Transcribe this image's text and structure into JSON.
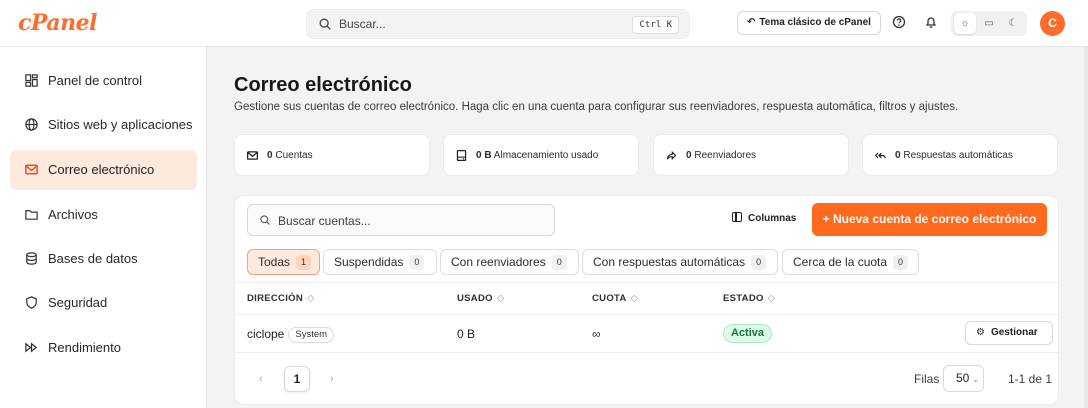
{
  "header": {
    "logo": "cPanel",
    "search_placeholder": "Buscar...",
    "search_shortcut": "Ctrl K",
    "theme_button": "Tema clásico de cPanel",
    "avatar_initial": "C",
    "accent_color": "#ff6c2c"
  },
  "sidebar": {
    "items": [
      {
        "label": "Panel de control",
        "icon": "dashboard-icon"
      },
      {
        "label": "Sitios web y aplicaciones",
        "icon": "globe-icon"
      },
      {
        "label": "Correo electrónico",
        "icon": "mail-icon",
        "active": true
      },
      {
        "label": "Archivos",
        "icon": "folder-icon"
      },
      {
        "label": "Bases de datos",
        "icon": "database-icon"
      },
      {
        "label": "Seguridad",
        "icon": "shield-icon"
      },
      {
        "label": "Rendimiento",
        "icon": "fast-forward-icon"
      }
    ]
  },
  "main": {
    "title": "Correo electrónico",
    "description": "Gestione sus cuentas de correo electrónico. Haga clic en una cuenta para configurar sus reenviadores, respuesta automática, filtros y ajustes.",
    "stats": [
      {
        "value": "0",
        "label": "Cuentas",
        "icon": "mail-icon"
      },
      {
        "value": "0 B",
        "label": "Almacenamiento usado",
        "icon": "hard-drive-icon"
      },
      {
        "value": "0",
        "label": "Reenviadores",
        "icon": "forward-icon"
      },
      {
        "value": "0",
        "label": "Respuestas automáticas",
        "icon": "reply-all-icon"
      }
    ],
    "search_placeholder": "Buscar cuentas...",
    "columns_button": "Columnas",
    "new_button": "+ Nueva cuenta de correo electrónico",
    "tabs": [
      {
        "label": "Todas",
        "count": "1"
      },
      {
        "label": "Suspendidas",
        "count": "0"
      },
      {
        "label": "Con reenviadores",
        "count": "0"
      },
      {
        "label": "Con respuestas automáticas",
        "count": "0"
      },
      {
        "label": "Cerca de la cuota",
        "count": "0"
      }
    ],
    "table": {
      "headers": [
        "DIRECCIÓN",
        "USADO",
        "CUOTA",
        "ESTADO"
      ],
      "sort_glyph": "◇",
      "rows": [
        {
          "address": "ciclope",
          "badge": "System",
          "used": "0 B",
          "quota": "∞",
          "status": "Activa",
          "action": "Gestionar"
        }
      ]
    },
    "pagination": {
      "prev": "‹",
      "current": "1",
      "next": "›",
      "rows_label": "Filas",
      "rows_value": "50",
      "range": "1-1 de 1"
    }
  }
}
